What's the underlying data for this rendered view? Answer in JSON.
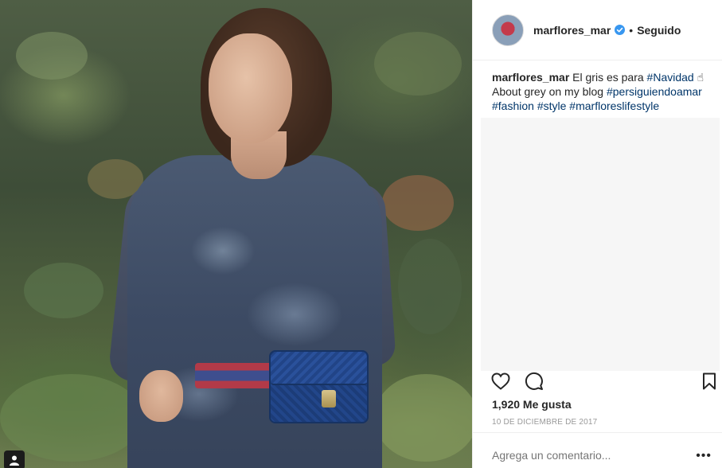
{
  "post": {
    "username": "marflores_mar",
    "verified_icon": "verified-badge-icon",
    "separator": "•",
    "follow_status": "Seguido"
  },
  "caption": {
    "username": "marflores_mar",
    "text_1": " El gris es para ",
    "tag_navidad": "#Navidad",
    "emoji": "☝",
    "text_2": "About grey on my blog ",
    "tag_blog": "#persiguiendoamar",
    "tag_fashion": "#fashion",
    "tag_style": "#style",
    "tag_lifestyle": "#marfloreslifestyle"
  },
  "actions": {
    "like_icon": "heart-icon",
    "comment_icon": "comment-icon",
    "save_icon": "bookmark-icon"
  },
  "likes": "1,920 Me gusta",
  "date": "10 DE DICIEMBRE DE 2017",
  "comment": {
    "placeholder": "Agrega un comentario...",
    "more": "•••"
  },
  "colors": {
    "accent_link": "#003569",
    "verified_blue": "#3897f0"
  }
}
